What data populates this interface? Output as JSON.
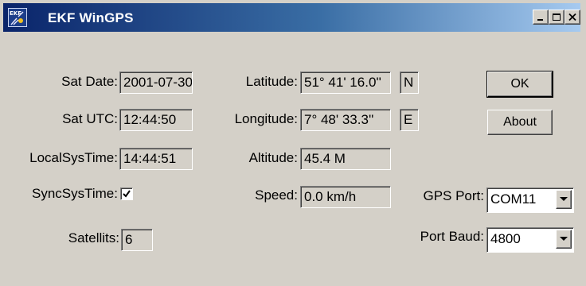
{
  "window": {
    "title": "EKF WinGPS",
    "app_icon": "ekf-satellite-icon",
    "controls": [
      "minimize-icon",
      "maximize-icon",
      "close-icon"
    ]
  },
  "fields": {
    "sat_date": {
      "label": "Sat Date:",
      "value": "2001-07-30"
    },
    "sat_utc": {
      "label": "Sat UTC:",
      "value": "12:44:50"
    },
    "local_sys_time": {
      "label": "LocalSysTime:",
      "value": "14:44:51"
    },
    "sync_sys_time": {
      "label": "SyncSysTime:",
      "checked": true
    },
    "satellits": {
      "label": "Satellits:",
      "value": "6"
    },
    "latitude": {
      "label": "Latitude:",
      "value": "51° 41' 16.0''",
      "hemisphere": "N"
    },
    "longitude": {
      "label": "Longitude:",
      "value": "7° 48' 33.3''",
      "hemisphere": "E"
    },
    "altitude": {
      "label": "Altitude:",
      "value": "45.4 M"
    },
    "speed": {
      "label": "Speed:",
      "value": "0.0 km/h"
    },
    "gps_port": {
      "label": "GPS Port:",
      "value": "COM11"
    },
    "port_baud": {
      "label": "Port Baud:",
      "value": "4800"
    }
  },
  "buttons": {
    "ok": "OK",
    "about": "About"
  },
  "colors": {
    "face": "#d4d0c8",
    "title_start": "#0a246a",
    "title_end": "#a6caf0",
    "title_text": "#ffffff"
  }
}
